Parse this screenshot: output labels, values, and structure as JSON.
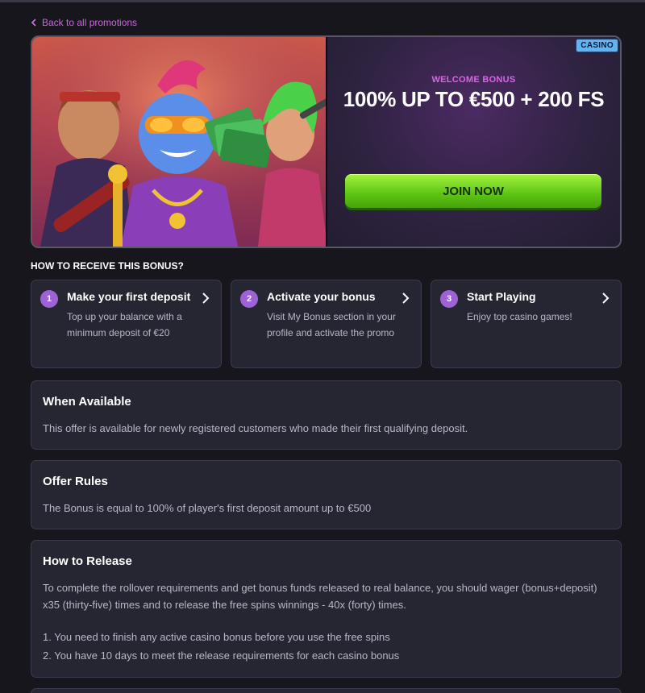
{
  "nav": {
    "back_label": "Back to all promotions"
  },
  "banner": {
    "badge": "CASINO",
    "welcome_label": "WELCOME BONUS",
    "headline": "100% UP TO €500 + 200 FS",
    "join_label": "JOIN NOW"
  },
  "how_to": {
    "heading": "HOW TO RECEIVE THIS BONUS?",
    "steps": [
      {
        "num": "1",
        "title": "Make your first deposit",
        "desc": "Top up your balance with a minimum deposit of €20"
      },
      {
        "num": "2",
        "title": "Activate your bonus",
        "desc": "Visit My Bonus section in your profile and activate the promo"
      },
      {
        "num": "3",
        "title": "Start Playing",
        "desc": "Enjoy top casino games!"
      }
    ]
  },
  "sections": {
    "when_available": {
      "title": "When Available",
      "text": "This offer is available for newly registered customers who made their first qualifying deposit."
    },
    "offer_rules": {
      "title": "Offer Rules",
      "text": "The Bonus is equal to 100% of player's first deposit amount up to €500"
    },
    "how_to_release": {
      "title": "How to Release",
      "paragraph": "To complete the rollover requirements and get bonus funds released to real balance, you should wager (bonus+deposit) x35 (thirty-five) times and to release the free spins winnings - 40x (forty) times.",
      "rules": [
        "1. You need to finish any active casino bonus before you use the free spins",
        "2. You have 10 days to meet the release requirements for each casino bonus"
      ]
    }
  },
  "colors": {
    "background": "#17161d",
    "card": "#262633",
    "accent_purple": "#9d63d6",
    "link_pink": "#c86ad8",
    "cta_green": "#5cc413",
    "badge_blue": "#63b3f0"
  }
}
